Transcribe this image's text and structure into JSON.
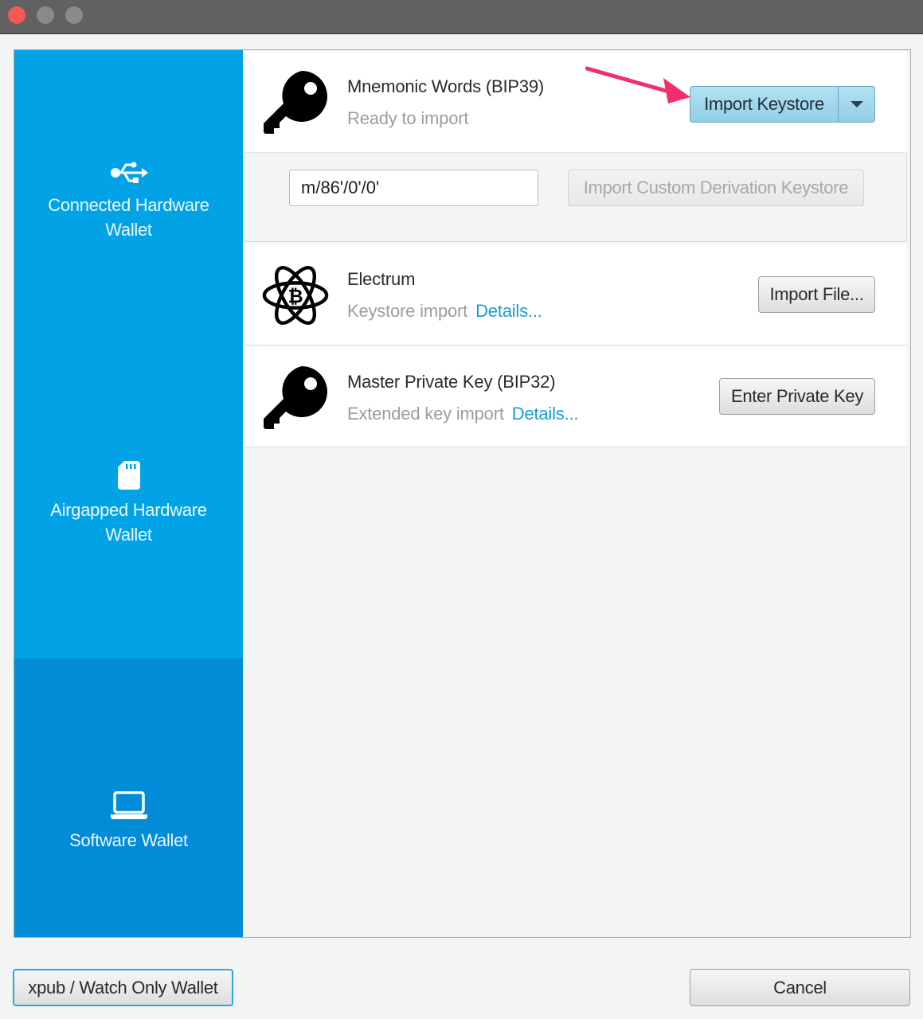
{
  "window": {
    "controls": [
      "close",
      "minimize",
      "maximize"
    ]
  },
  "sidebar": {
    "items": [
      {
        "label": "Connected Hardware Wallet",
        "line1": "Connected Hardware",
        "line2": "Wallet",
        "icon": "usb-icon",
        "selected": false
      },
      {
        "label": "Airgapped Hardware Wallet",
        "line1": "Airgapped Hardware",
        "line2": "Wallet",
        "icon": "sd-card-icon",
        "selected": false
      },
      {
        "label": "Software Wallet",
        "line1": "Software Wallet",
        "line2": "",
        "icon": "laptop-icon",
        "selected": true
      }
    ]
  },
  "options": {
    "mnemonic": {
      "title": "Mnemonic Words (BIP39)",
      "subtitle": "Ready to import",
      "icon": "key-icon",
      "action_label": "Import Keystore",
      "derivation_path": "m/86'/0'/0'",
      "custom_action_label": "Import Custom Derivation Keystore"
    },
    "electrum": {
      "title": "Electrum",
      "subtitle": "Keystore import",
      "details_label": "Details...",
      "icon": "electrum-bitcoin-atom-icon",
      "action_label": "Import File..."
    },
    "master": {
      "title": "Master Private Key (BIP32)",
      "subtitle": "Extended key import",
      "details_label": "Details...",
      "icon": "key-icon",
      "action_label": "Enter Private Key"
    }
  },
  "footer": {
    "watch_only_label": "xpub / Watch Only Wallet",
    "cancel_label": "Cancel"
  },
  "colors": {
    "sidebar": "#02a3e6",
    "sidebar_selected": "#028bd6",
    "link": "#1a9bd2",
    "primary_button": "#a5d9ee",
    "annotation_arrow": "#f0306a"
  }
}
